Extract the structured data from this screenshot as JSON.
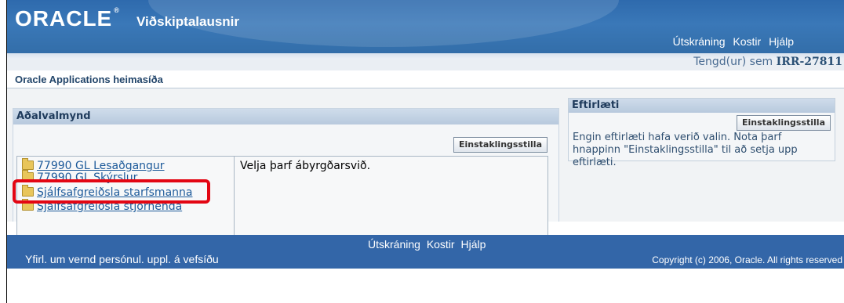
{
  "header": {
    "logo": "ORACLE",
    "app_title": "Viðskiptalausnir",
    "nav": {
      "logout": "Útskráning",
      "preferences": "Kostir",
      "help": "Hjálp"
    }
  },
  "user": {
    "prefix": "Tengd(ur) sem",
    "name": "IRR-27811"
  },
  "page_title": "Oracle Applications heimasíða",
  "main_menu": {
    "title": "Aðalvalmynd",
    "personalize_label": "Einstaklingsstilla",
    "responsibilities": [
      "77990 GL Lesaðgangur",
      "77990 GL Skýrslur",
      "Sjálfsafgreiðsla starfsmanna",
      "Sjálfsafgreiðsla stjórnenda"
    ],
    "message": "Velja þarf ábyrgðarsvið."
  },
  "preferences_panel": {
    "title": "Eftirlæti",
    "personalize_label": "Einstaklingsstilla",
    "message": "Engin eftirlæti hafa verið valin. Nota þarf hnappinn \"Einstaklingsstilla\" til að setja upp eftirlæti."
  },
  "footer": {
    "nav": {
      "logout": "Útskráning",
      "preferences": "Kostir",
      "help": "Hjálp"
    },
    "privacy": "Yfirl. um vernd persónul. uppl. á vefsíðu",
    "copyright": "Copyright (c) 2006, Oracle. All rights reserved"
  },
  "colors": {
    "header_blue": "#336ea9",
    "footer_blue": "#3366a8",
    "link_blue": "#1d5a9a",
    "highlight_red": "#e30613"
  }
}
